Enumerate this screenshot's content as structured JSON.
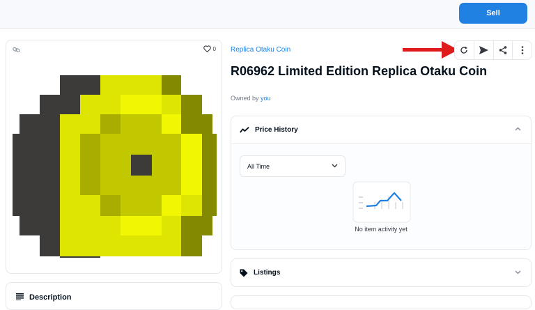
{
  "topbar": {
    "sell_label": "Sell"
  },
  "image_card": {
    "favorite_count": "0"
  },
  "description": {
    "label": "Description"
  },
  "item": {
    "collection": "Replica Otaku Coin",
    "title": "R06962 Limited Edition Replica Otaku Coin",
    "owner_prefix": "Owned by",
    "owner": "you"
  },
  "price_history": {
    "label": "Price History",
    "range_selected": "All Time",
    "empty_text": "No item activity yet"
  },
  "listings": {
    "label": "Listings"
  },
  "colors": {
    "accent": "#2081e2",
    "arrow": "#e01b1b",
    "coin_dark": "#3d3a3a",
    "coin_olive": "#848a00",
    "coin_mid": "#c2c800",
    "coin_light": "#dee500",
    "coin_bright": "#f0f700"
  }
}
